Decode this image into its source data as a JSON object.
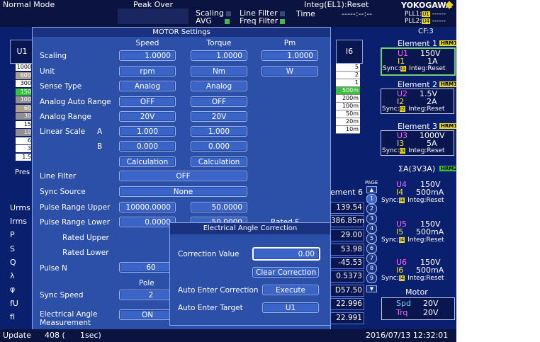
{
  "topbar": {
    "mode": "Normal Mode",
    "peak_over": "Peak Over",
    "scaling": "Scaling",
    "avg": "AVG",
    "line_filter": "Line Filter",
    "freq_filter": "Freq Filter",
    "integ": "Integ(EL1):Reset",
    "time_label": "Time",
    "time_value": "-----:--:--",
    "brand": "YOKOGAWA",
    "pll1": "PLL1:",
    "pll1_tag": "U1",
    "pll1_val": "------",
    "pll2": "PLL2:",
    "pll2_tag": "U4",
    "pll2_val": "------",
    "cf": "CF:3"
  },
  "motor_dialog": {
    "title": "MOTOR Settings",
    "columns": [
      "Speed",
      "Torque",
      "Pm"
    ],
    "scaling_label": "Scaling",
    "scaling": [
      "1.0000",
      "1.0000",
      "1.0000"
    ],
    "unit_label": "Unit",
    "unit": [
      "rpm",
      "Nm",
      "W"
    ],
    "sense_type_label": "Sense Type",
    "sense_type": [
      "Analog",
      "Analog"
    ],
    "analog_auto_range_label": "Analog Auto Range",
    "analog_auto_range": [
      "OFF",
      "OFF"
    ],
    "analog_range_label": "Analog Range",
    "analog_range": [
      "20V",
      "20V"
    ],
    "linear_scale_label": "Linear Scale",
    "a_label": "A",
    "a_values": [
      "1.000",
      "1.000"
    ],
    "b_label": "B",
    "b_values": [
      "0.000",
      "0.000"
    ],
    "calculation": [
      "Calculation",
      "Calculation"
    ],
    "line_filter_label": "Line Filter",
    "line_filter": "OFF",
    "sync_source_label": "Sync Source",
    "sync_source": "None",
    "pulse_range_upper_label": "Pulse Range Upper",
    "pulse_range_upper": [
      "10000.0000",
      "50.0000"
    ],
    "pulse_range_lower_label": "Pulse Range Lower",
    "pulse_range_lower": [
      "0.0000",
      "-50.0000"
    ],
    "rated_upper_label": "Rated Upper",
    "rated_lower_label": "Rated Lower",
    "rated_partial": "Rated F",
    "pulse_n_label": "Pulse N",
    "pulse_n": "60",
    "pole_label": "Pole",
    "sync_speed_label": "Sync Speed",
    "sync_speed": "2",
    "electrical_angle_label_1": "Electrical Angle",
    "electrical_angle_label_2": "Measurement",
    "electrical_angle": "ON"
  },
  "elec_dialog": {
    "title": "Electrical Angle Correction",
    "correction_value_label": "Correction Value",
    "correction_value": "0.00",
    "clear_correction": "Clear Correction",
    "auto_enter_correction_label": "Auto Enter Correction",
    "execute": "Execute",
    "auto_enter_target_label": "Auto Enter Target",
    "auto_enter_target": "U1"
  },
  "left_data": {
    "u1_label": "U1",
    "range_values": [
      "1000",
      "600",
      "300",
      "150",
      "100",
      "60",
      "30",
      "15",
      "10",
      "6",
      "3",
      "1.5"
    ],
    "pres": "Pres",
    "row_labels": [
      "Urms",
      "Irms",
      "P",
      "S",
      "Q",
      "λ",
      "φ",
      "fU",
      "fI"
    ]
  },
  "range_list": {
    "label": "I6",
    "values": [
      "5",
      "2",
      "1",
      "500m",
      "200m",
      "100m",
      "50m",
      "20m",
      "10m"
    ]
  },
  "element6": {
    "header": "ement 6",
    "values": [
      "139.54",
      "386.85m",
      "29.00",
      "53.98",
      "-45.53",
      "0.5373",
      "D57.50",
      "22.996",
      "22.991"
    ]
  },
  "page": {
    "label": "PAGE",
    "numbers": [
      "1",
      "2",
      "3",
      "4",
      "5",
      "6",
      "7",
      "8",
      "9"
    ]
  },
  "elements": [
    {
      "title": "Element 1",
      "hrm": "HRM1",
      "v_tag": "U1",
      "v": "150V",
      "i_tag": "I1",
      "i": "1A",
      "sync": "Sync:",
      "sync_tag": "I1",
      "integ": "Integ:Reset"
    },
    {
      "title": "Element 2",
      "hrm": "HRM1",
      "v_tag": "U2",
      "v": "1.5V",
      "i_tag": "I2",
      "i": "2A",
      "sync": "Sync:",
      "sync_tag": "I2",
      "integ": "Integ:Reset"
    },
    {
      "title": "Element 3",
      "hrm": "HRM1",
      "v_tag": "U3",
      "v": "1000V",
      "i_tag": "I3",
      "i": "5A",
      "sync": "Sync:",
      "sync_tag": "I3",
      "integ": "Integ:Reset"
    }
  ],
  "sigma": {
    "title": "ΣA(3V3A)",
    "hrm": "HRM2",
    "groups": [
      {
        "v_tag": "U4",
        "v": "150V",
        "i_tag": "I4",
        "i": "500mA",
        "sync": "Sync:",
        "sync_tag": "I4",
        "integ": "Integ:Reset"
      },
      {
        "v_tag": "U5",
        "v": "150V",
        "i_tag": "I5",
        "i": "500mA",
        "sync": "Sync:",
        "sync_tag": "I4",
        "integ": "Integ:Reset"
      },
      {
        "v_tag": "U6",
        "v": "150V",
        "i_tag": "I6",
        "i": "500mA",
        "sync": "Sync:",
        "sync_tag": "I4",
        "integ": "Integ:Reset"
      }
    ]
  },
  "motor_panel": {
    "title": "Motor",
    "spd_label": "Spd",
    "spd": "20V",
    "trq_label": "Trq",
    "trq": "20V"
  },
  "bottombar": {
    "update": "Update",
    "count": "408 (",
    "interval": "1sec)",
    "datetime": "2016/07/13 12:32:01"
  },
  "colors": {
    "background": "#0a1f6e",
    "dialog": "#2c4fa8",
    "field": "#3a64c8",
    "selected_green": "#6fd16f",
    "voltage_magenta": "#ff60ff",
    "current_yellow": "#f0e040",
    "brand_yellow": "#f0d020"
  }
}
